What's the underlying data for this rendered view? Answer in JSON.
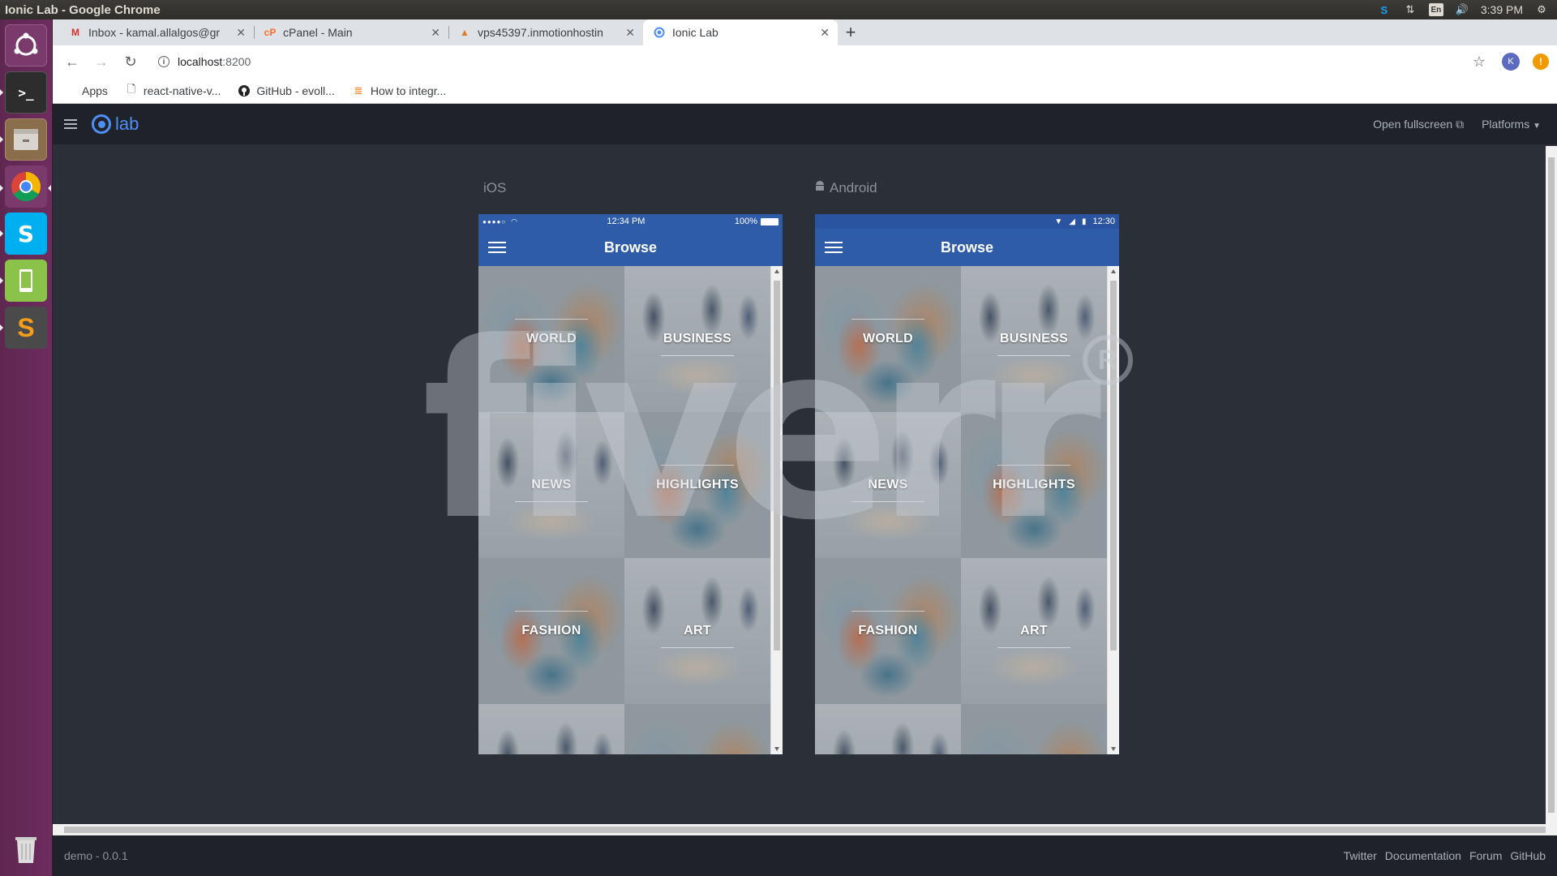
{
  "os": {
    "window_title": "Ionic Lab - Google Chrome",
    "clock": "3:39 PM",
    "lang": "En"
  },
  "launcher": {
    "apps": [
      "ubuntu-icon",
      "terminal-icon",
      "files-icon",
      "chrome-icon",
      "skype-icon",
      "phone-icon",
      "sublime-text-icon",
      "trash-icon"
    ]
  },
  "browser": {
    "tabs": [
      {
        "label": "Inbox - kamal.allalgos@gr",
        "icon": "gmail-icon"
      },
      {
        "label": "cPanel - Main",
        "icon": "cpanel-icon"
      },
      {
        "label": "vps45397.inmotionhostin",
        "icon": "inmotion-icon"
      },
      {
        "label": "Ionic Lab",
        "icon": "ionic-icon"
      }
    ],
    "url_host": "localhost",
    "url_port": ":8200",
    "profile_initial": "K",
    "bookmarks": [
      {
        "label": "Apps",
        "icon": "apps-grid-icon"
      },
      {
        "label": "react-native-v...",
        "icon": "page-icon"
      },
      {
        "label": "GitHub - evoll...",
        "icon": "github-icon"
      },
      {
        "label": "How to integr...",
        "icon": "stackoverflow-icon"
      }
    ]
  },
  "lab": {
    "logo_text": "lab",
    "open_fullscreen": "Open fullscreen",
    "platforms": "Platforms",
    "ios_label": "iOS",
    "android_label": "Android",
    "ios_status": {
      "carrier_dots": "●●●●○",
      "time": "12:34 PM",
      "battery": "100%"
    },
    "android_status": {
      "time": "12:30"
    },
    "page_title": "Browse",
    "tiles": [
      "WORLD",
      "BUSINESS",
      "NEWS",
      "HIGHLIGHTS",
      "FASHION",
      "ART"
    ],
    "version": "demo - 0.0.1",
    "footer_links": [
      "Twitter",
      "Documentation",
      "Forum",
      "GitHub"
    ],
    "watermark": "fiverr"
  },
  "colors": {
    "ionic_blue": "#4e8ef7",
    "app_toolbar": "#2e5ca8",
    "lab_bg": "#2a2f38",
    "launcher": "#5e2750"
  }
}
